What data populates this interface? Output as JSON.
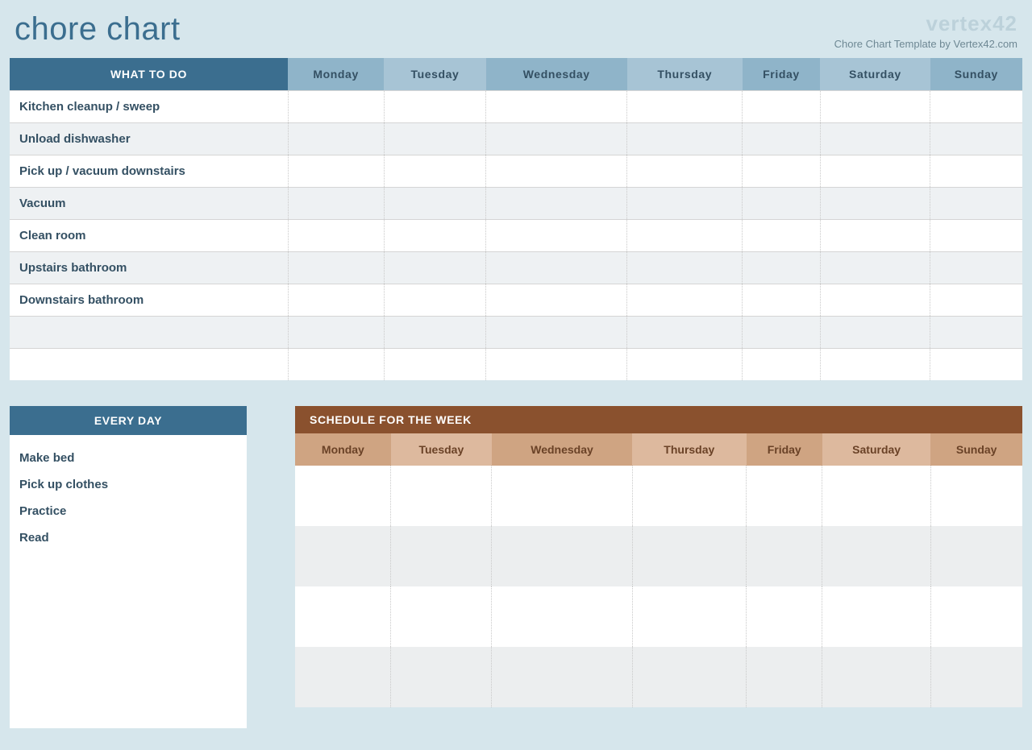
{
  "title": "chore chart",
  "brand_logo": "vertex42",
  "brand_caption": "Chore Chart Template by Vertex42.com",
  "todo_header": "WHAT TO DO",
  "days": [
    "Monday",
    "Tuesday",
    "Wednesday",
    "Thursday",
    "Friday",
    "Saturday",
    "Sunday"
  ],
  "chores": [
    "Kitchen cleanup / sweep",
    "Unload dishwasher",
    "Pick up / vacuum downstairs",
    "Vacuum",
    "Clean room",
    "Upstairs bathroom",
    "Downstairs bathroom",
    "",
    ""
  ],
  "everyday_header": "EVERY DAY",
  "everyday_items": [
    "Make bed",
    "Pick up clothes",
    "Practice",
    "Read"
  ],
  "schedule_header": "SCHEDULE FOR THE WEEK",
  "schedule_rows": 4
}
